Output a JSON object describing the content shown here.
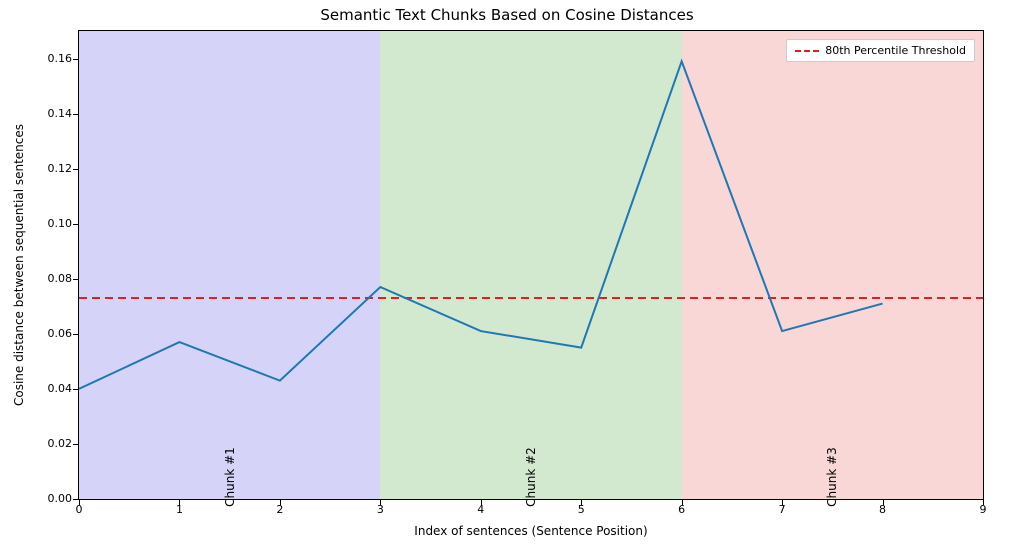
{
  "chart_data": {
    "type": "line",
    "title": "Semantic Text Chunks Based on Cosine Distances",
    "xlabel": "Index of sentences (Sentence Position)",
    "ylabel": "Cosine distance between sequential sentences",
    "x": [
      0,
      1,
      2,
      3,
      4,
      5,
      6,
      7,
      8
    ],
    "values": [
      0.04,
      0.057,
      0.043,
      0.077,
      0.061,
      0.055,
      0.159,
      0.061,
      0.071
    ],
    "xlim": [
      0,
      9
    ],
    "ylim": [
      0.0,
      0.17
    ],
    "xticks": [
      0,
      1,
      2,
      3,
      4,
      5,
      6,
      7,
      8,
      9
    ],
    "yticks": [
      0.0,
      0.02,
      0.04,
      0.06,
      0.08,
      0.1,
      0.12,
      0.14,
      0.16
    ],
    "threshold": {
      "value": 0.073,
      "label": "80th Percentile Threshold"
    },
    "chunks": [
      {
        "label": "Chunk #1",
        "start": 0,
        "end": 3,
        "color": "#abaaf2"
      },
      {
        "label": "Chunk #2",
        "start": 3,
        "end": 6,
        "color": "#a7d3a0"
      },
      {
        "label": "Chunk #3",
        "start": 6,
        "end": 9,
        "color": "#f2b0ae"
      }
    ]
  }
}
